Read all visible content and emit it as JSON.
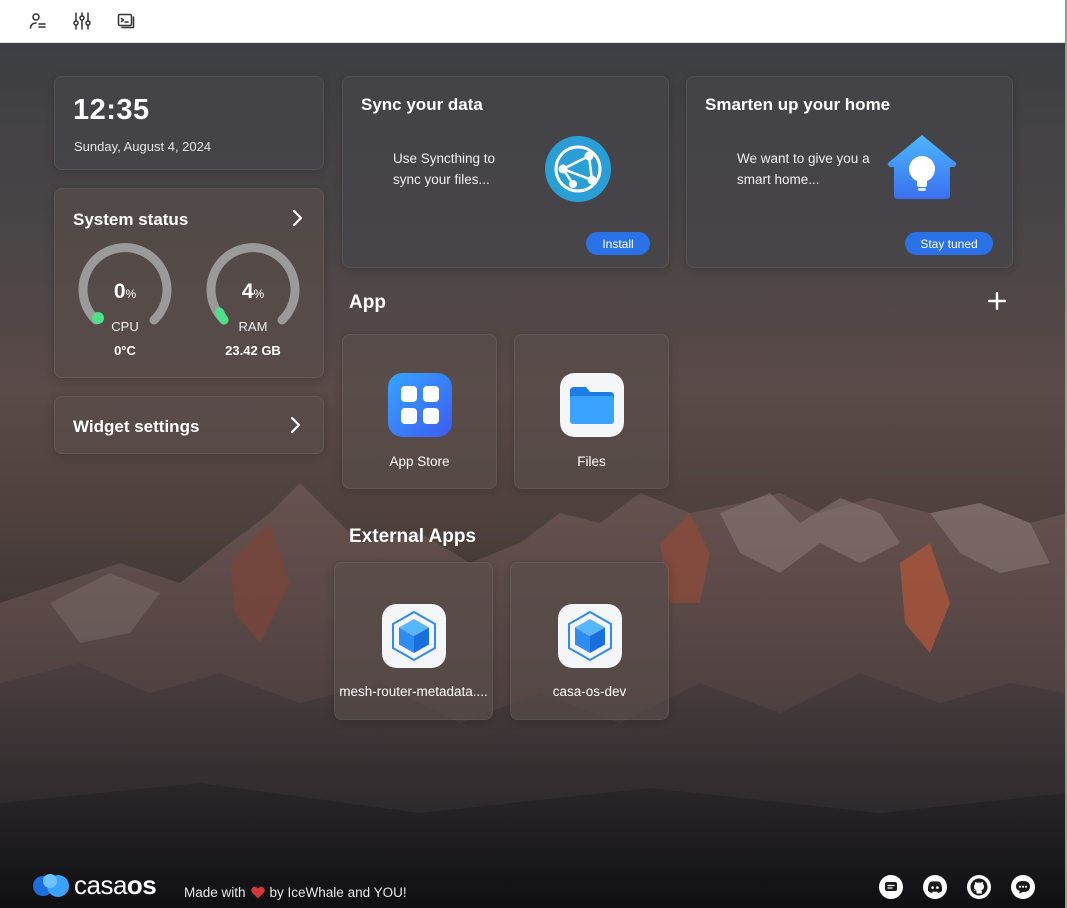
{
  "toolbar": {
    "buttons": [
      {
        "icon": "account-icon"
      },
      {
        "icon": "settings-sliders-icon"
      },
      {
        "icon": "terminal-icon"
      }
    ]
  },
  "clock": {
    "time": "12:35",
    "date": "Sunday, August 4, 2024"
  },
  "system_status": {
    "title": "System status",
    "cpu": {
      "value": "0",
      "unit": "%",
      "label": "CPU",
      "sub": "0°C",
      "percent": 0
    },
    "ram": {
      "value": "4",
      "unit": "%",
      "label": "RAM",
      "sub": "23.42 GB",
      "percent": 4
    }
  },
  "widget_settings": {
    "title": "Widget settings"
  },
  "promo_sync": {
    "title": "Sync your data",
    "text": "Use Syncthing to sync your files...",
    "button": "Install"
  },
  "promo_home": {
    "title": "Smarten up your home",
    "text": "We want to give you a smart home...",
    "button": "Stay tuned"
  },
  "apps_section": {
    "title": "App",
    "apps": [
      {
        "name": "App Store",
        "icon": "app-store-icon"
      },
      {
        "name": "Files",
        "icon": "files-folder-icon"
      }
    ]
  },
  "external_section": {
    "title": "External Apps",
    "apps": [
      {
        "name": "mesh-router-metadata....",
        "icon": "cube-icon"
      },
      {
        "name": "casa-os-dev",
        "icon": "cube-icon"
      }
    ]
  },
  "footer": {
    "logo_part1": "casa",
    "logo_part2": "os",
    "made_with": "Made with",
    "by": "by IceWhale and YOU!",
    "icons": [
      "feedback-icon",
      "discord-icon",
      "github-icon",
      "community-icon"
    ]
  },
  "colors": {
    "accent": "#2b72e8",
    "gauge_indicator": "#4fe08a",
    "gauge_track": "#9a9a9a"
  }
}
